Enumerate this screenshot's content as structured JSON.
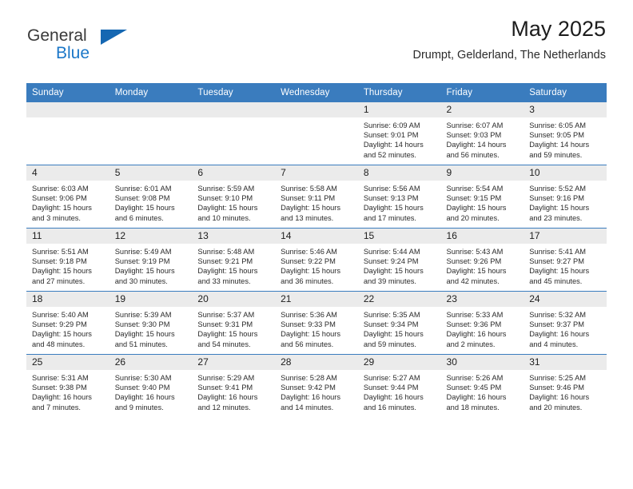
{
  "logo": {
    "line1": "General",
    "line2": "Blue",
    "triangle_icon": "triangle-icon",
    "blue": "#1567b2",
    "text_blue": "#1b77c8"
  },
  "header": {
    "title": "May 2025",
    "subtitle": "Drumpt, Gelderland, The Netherlands"
  },
  "theme": {
    "header_blue": "#3a7cbe",
    "daynum_gray": "#ebebeb"
  },
  "weekdays": [
    "Sunday",
    "Monday",
    "Tuesday",
    "Wednesday",
    "Thursday",
    "Friday",
    "Saturday"
  ],
  "labels": {
    "sunrise": "Sunrise:",
    "sunset": "Sunset:",
    "daylight": "Daylight:"
  },
  "weeks": [
    [
      {
        "day": "",
        "empty": true
      },
      {
        "day": "",
        "empty": true
      },
      {
        "day": "",
        "empty": true
      },
      {
        "day": "",
        "empty": true
      },
      {
        "day": "1",
        "sunrise": "Sunrise: 6:09 AM",
        "sunset": "Sunset: 9:01 PM",
        "daylight": "Daylight: 14 hours and 52 minutes."
      },
      {
        "day": "2",
        "sunrise": "Sunrise: 6:07 AM",
        "sunset": "Sunset: 9:03 PM",
        "daylight": "Daylight: 14 hours and 56 minutes."
      },
      {
        "day": "3",
        "sunrise": "Sunrise: 6:05 AM",
        "sunset": "Sunset: 9:05 PM",
        "daylight": "Daylight: 14 hours and 59 minutes."
      }
    ],
    [
      {
        "day": "4",
        "sunrise": "Sunrise: 6:03 AM",
        "sunset": "Sunset: 9:06 PM",
        "daylight": "Daylight: 15 hours and 3 minutes."
      },
      {
        "day": "5",
        "sunrise": "Sunrise: 6:01 AM",
        "sunset": "Sunset: 9:08 PM",
        "daylight": "Daylight: 15 hours and 6 minutes."
      },
      {
        "day": "6",
        "sunrise": "Sunrise: 5:59 AM",
        "sunset": "Sunset: 9:10 PM",
        "daylight": "Daylight: 15 hours and 10 minutes."
      },
      {
        "day": "7",
        "sunrise": "Sunrise: 5:58 AM",
        "sunset": "Sunset: 9:11 PM",
        "daylight": "Daylight: 15 hours and 13 minutes."
      },
      {
        "day": "8",
        "sunrise": "Sunrise: 5:56 AM",
        "sunset": "Sunset: 9:13 PM",
        "daylight": "Daylight: 15 hours and 17 minutes."
      },
      {
        "day": "9",
        "sunrise": "Sunrise: 5:54 AM",
        "sunset": "Sunset: 9:15 PM",
        "daylight": "Daylight: 15 hours and 20 minutes."
      },
      {
        "day": "10",
        "sunrise": "Sunrise: 5:52 AM",
        "sunset": "Sunset: 9:16 PM",
        "daylight": "Daylight: 15 hours and 23 minutes."
      }
    ],
    [
      {
        "day": "11",
        "sunrise": "Sunrise: 5:51 AM",
        "sunset": "Sunset: 9:18 PM",
        "daylight": "Daylight: 15 hours and 27 minutes."
      },
      {
        "day": "12",
        "sunrise": "Sunrise: 5:49 AM",
        "sunset": "Sunset: 9:19 PM",
        "daylight": "Daylight: 15 hours and 30 minutes."
      },
      {
        "day": "13",
        "sunrise": "Sunrise: 5:48 AM",
        "sunset": "Sunset: 9:21 PM",
        "daylight": "Daylight: 15 hours and 33 minutes."
      },
      {
        "day": "14",
        "sunrise": "Sunrise: 5:46 AM",
        "sunset": "Sunset: 9:22 PM",
        "daylight": "Daylight: 15 hours and 36 minutes."
      },
      {
        "day": "15",
        "sunrise": "Sunrise: 5:44 AM",
        "sunset": "Sunset: 9:24 PM",
        "daylight": "Daylight: 15 hours and 39 minutes."
      },
      {
        "day": "16",
        "sunrise": "Sunrise: 5:43 AM",
        "sunset": "Sunset: 9:26 PM",
        "daylight": "Daylight: 15 hours and 42 minutes."
      },
      {
        "day": "17",
        "sunrise": "Sunrise: 5:41 AM",
        "sunset": "Sunset: 9:27 PM",
        "daylight": "Daylight: 15 hours and 45 minutes."
      }
    ],
    [
      {
        "day": "18",
        "sunrise": "Sunrise: 5:40 AM",
        "sunset": "Sunset: 9:29 PM",
        "daylight": "Daylight: 15 hours and 48 minutes."
      },
      {
        "day": "19",
        "sunrise": "Sunrise: 5:39 AM",
        "sunset": "Sunset: 9:30 PM",
        "daylight": "Daylight: 15 hours and 51 minutes."
      },
      {
        "day": "20",
        "sunrise": "Sunrise: 5:37 AM",
        "sunset": "Sunset: 9:31 PM",
        "daylight": "Daylight: 15 hours and 54 minutes."
      },
      {
        "day": "21",
        "sunrise": "Sunrise: 5:36 AM",
        "sunset": "Sunset: 9:33 PM",
        "daylight": "Daylight: 15 hours and 56 minutes."
      },
      {
        "day": "22",
        "sunrise": "Sunrise: 5:35 AM",
        "sunset": "Sunset: 9:34 PM",
        "daylight": "Daylight: 15 hours and 59 minutes."
      },
      {
        "day": "23",
        "sunrise": "Sunrise: 5:33 AM",
        "sunset": "Sunset: 9:36 PM",
        "daylight": "Daylight: 16 hours and 2 minutes."
      },
      {
        "day": "24",
        "sunrise": "Sunrise: 5:32 AM",
        "sunset": "Sunset: 9:37 PM",
        "daylight": "Daylight: 16 hours and 4 minutes."
      }
    ],
    [
      {
        "day": "25",
        "sunrise": "Sunrise: 5:31 AM",
        "sunset": "Sunset: 9:38 PM",
        "daylight": "Daylight: 16 hours and 7 minutes."
      },
      {
        "day": "26",
        "sunrise": "Sunrise: 5:30 AM",
        "sunset": "Sunset: 9:40 PM",
        "daylight": "Daylight: 16 hours and 9 minutes."
      },
      {
        "day": "27",
        "sunrise": "Sunrise: 5:29 AM",
        "sunset": "Sunset: 9:41 PM",
        "daylight": "Daylight: 16 hours and 12 minutes."
      },
      {
        "day": "28",
        "sunrise": "Sunrise: 5:28 AM",
        "sunset": "Sunset: 9:42 PM",
        "daylight": "Daylight: 16 hours and 14 minutes."
      },
      {
        "day": "29",
        "sunrise": "Sunrise: 5:27 AM",
        "sunset": "Sunset: 9:44 PM",
        "daylight": "Daylight: 16 hours and 16 minutes."
      },
      {
        "day": "30",
        "sunrise": "Sunrise: 5:26 AM",
        "sunset": "Sunset: 9:45 PM",
        "daylight": "Daylight: 16 hours and 18 minutes."
      },
      {
        "day": "31",
        "sunrise": "Sunrise: 5:25 AM",
        "sunset": "Sunset: 9:46 PM",
        "daylight": "Daylight: 16 hours and 20 minutes."
      }
    ]
  ]
}
